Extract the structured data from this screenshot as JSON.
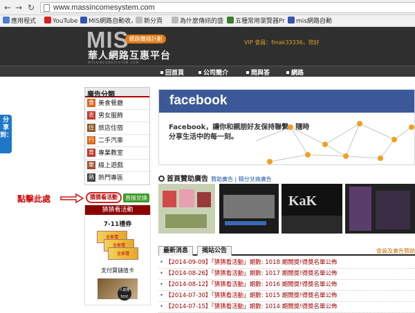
{
  "browser": {
    "url": "www.massincomesystem.com",
    "bookmarks": [
      {
        "label": "應用程式",
        "color": "#4a7fd4"
      },
      {
        "label": "YouTube",
        "color": "#d62020"
      },
      {
        "label": "MIS網路自動收入系...",
        "color": "#3355aa"
      },
      {
        "label": "新分頁",
        "color": "#888888"
      },
      {
        "label": "為什麼傳訊的盛況...",
        "color": "#888888"
      },
      {
        "label": "五種常用瀏覽器Pro...",
        "color": "#3b7d2f"
      },
      {
        "label": "mis網路自動",
        "color": "#3355aa"
      }
    ]
  },
  "header": {
    "logo": "MIS",
    "logo_tag": "網路賺錢計劃",
    "subtitle": "華人網路互惠平台",
    "tiny": "MASSINCOMESYSTEM.COM",
    "vip": "VIP 會員：fmak33336，您好"
  },
  "menu": [
    "回首頁",
    "公司簡介",
    "問與答",
    "網路"
  ],
  "side_share": "分享到：",
  "categories": {
    "title": "廣告分類",
    "items": [
      {
        "icon": "食",
        "label": "美食餐廳",
        "color": "#d9671b"
      },
      {
        "icon": "衣",
        "label": "男女服飾",
        "color": "#c0392b"
      },
      {
        "icon": "住",
        "label": "旅店住宿",
        "color": "#8e5a2c"
      },
      {
        "icon": "行",
        "label": "二手汽車",
        "color": "#d9671b"
      },
      {
        "icon": "育",
        "label": "專業教室",
        "color": "#c0392b"
      },
      {
        "icon": "樂",
        "label": "線上遊戲",
        "color": "#a0522d"
      },
      {
        "icon": "熱",
        "label": "熱門專區",
        "color": "#444444"
      }
    ]
  },
  "callout": "點擊此處",
  "activity_button": "猜猜看活動",
  "exchange_button": "直接兌換",
  "promo": {
    "title": "猜猜看活動",
    "voucher_label": "7-11禮券",
    "ticket_text": "全家禮",
    "card_label": "支付寶儲值卡",
    "badge_text": "人氣榜 50元"
  },
  "facebook": {
    "logo": "facebook",
    "line1": "Facebook，讓你和親朋好友保持聯繫，隨時",
    "line2": "分享生活中的每一刻。"
  },
  "sponsor": {
    "title": "首頁贊助廣告",
    "links": "贊助廣告 | 積分兌換廣告"
  },
  "tabs": {
    "latest": "最新消息",
    "board": "揭站公告",
    "note": "會員及廣告贊助"
  },
  "news": [
    {
      "date": "【2014-09-09】",
      "name": "「猜猜看活動」",
      "text": "期數: 1018 期開獎!得獎名單公佈"
    },
    {
      "date": "【2014-08-26】",
      "name": "「猜猜看活動」",
      "text": "期數: 1017 期開獎!得獎名單公佈"
    },
    {
      "date": "【2014-08-12】",
      "name": "「猜猜看活動」",
      "text": "期數: 1016 期開獎!得獎名單公佈"
    },
    {
      "date": "【2014-07-30】",
      "name": "「猜猜看活動」",
      "text": "期數: 1015 期開獎!得獎名單公佈"
    },
    {
      "date": "【2014-07-15】",
      "name": "「猜猜看活動」",
      "text": "期數: 1014 期開獎!得獎名單公佈"
    }
  ]
}
